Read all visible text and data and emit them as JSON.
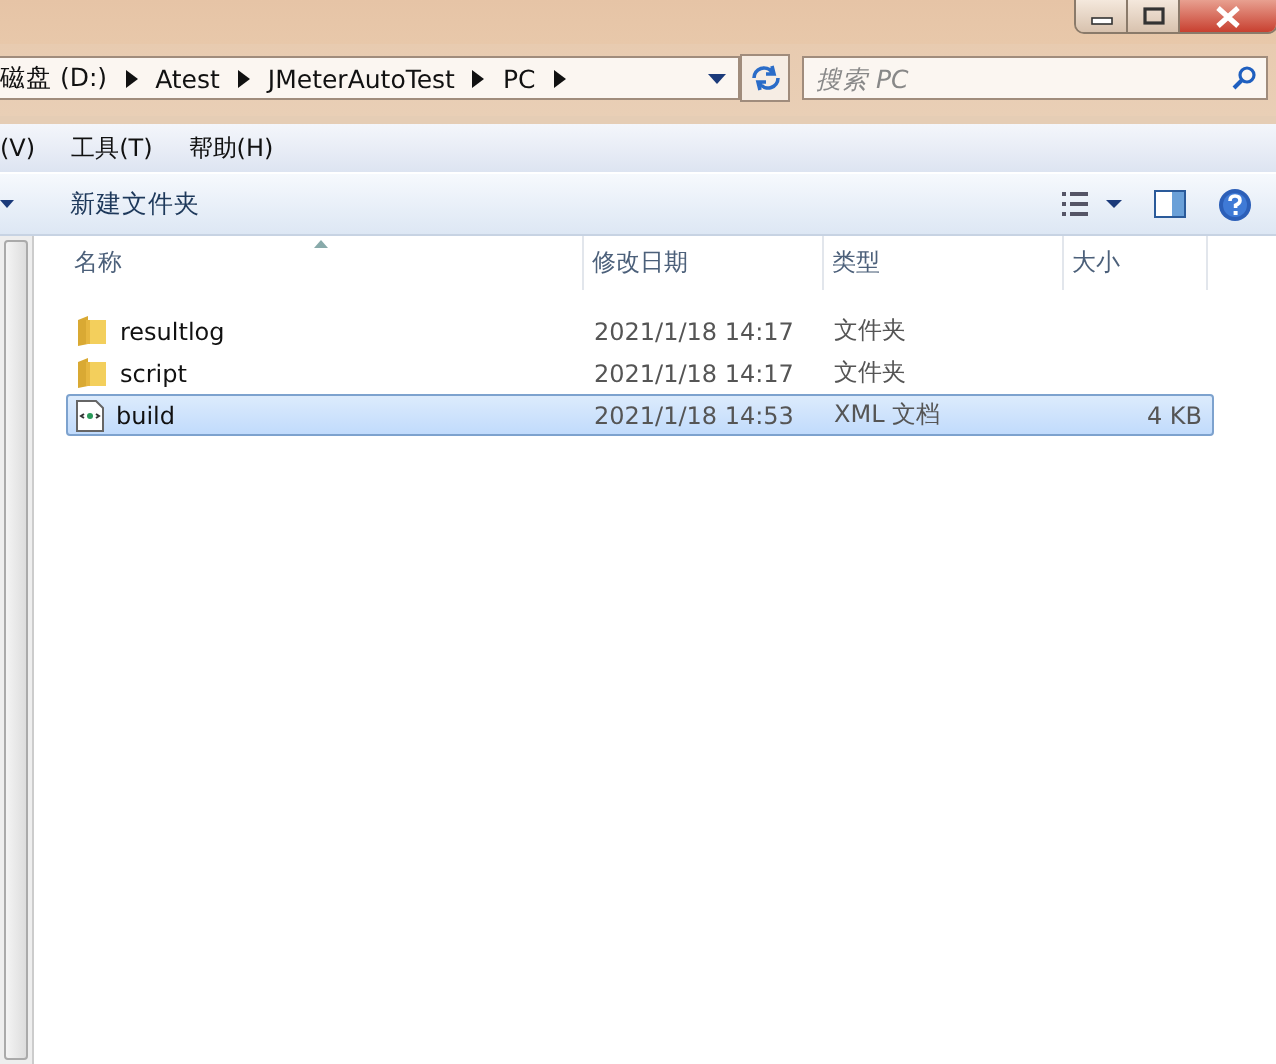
{
  "address_bar": {
    "crumbs": [
      "磁盘 (D:)",
      "Atest",
      "JMeterAutoTest",
      "PC"
    ]
  },
  "search": {
    "placeholder": "搜索 PC"
  },
  "menu": [
    "(V)",
    "工具(T)",
    "帮助(H)"
  ],
  "toolbar": {
    "new_folder": "新建文件夹"
  },
  "table": {
    "columns": [
      "名称",
      "修改日期",
      "类型",
      "大小"
    ],
    "rows": [
      {
        "kind": "folder",
        "name": "resultlog",
        "date": "2021/1/18 14:17",
        "type": "文件夹",
        "size": "",
        "selected": false
      },
      {
        "kind": "folder",
        "name": "script",
        "date": "2021/1/18 14:17",
        "type": "文件夹",
        "size": "",
        "selected": false
      },
      {
        "kind": "xml",
        "name": "build",
        "date": "2021/1/18 14:53",
        "type": "XML 文档",
        "size": "4 KB",
        "selected": true
      }
    ]
  }
}
